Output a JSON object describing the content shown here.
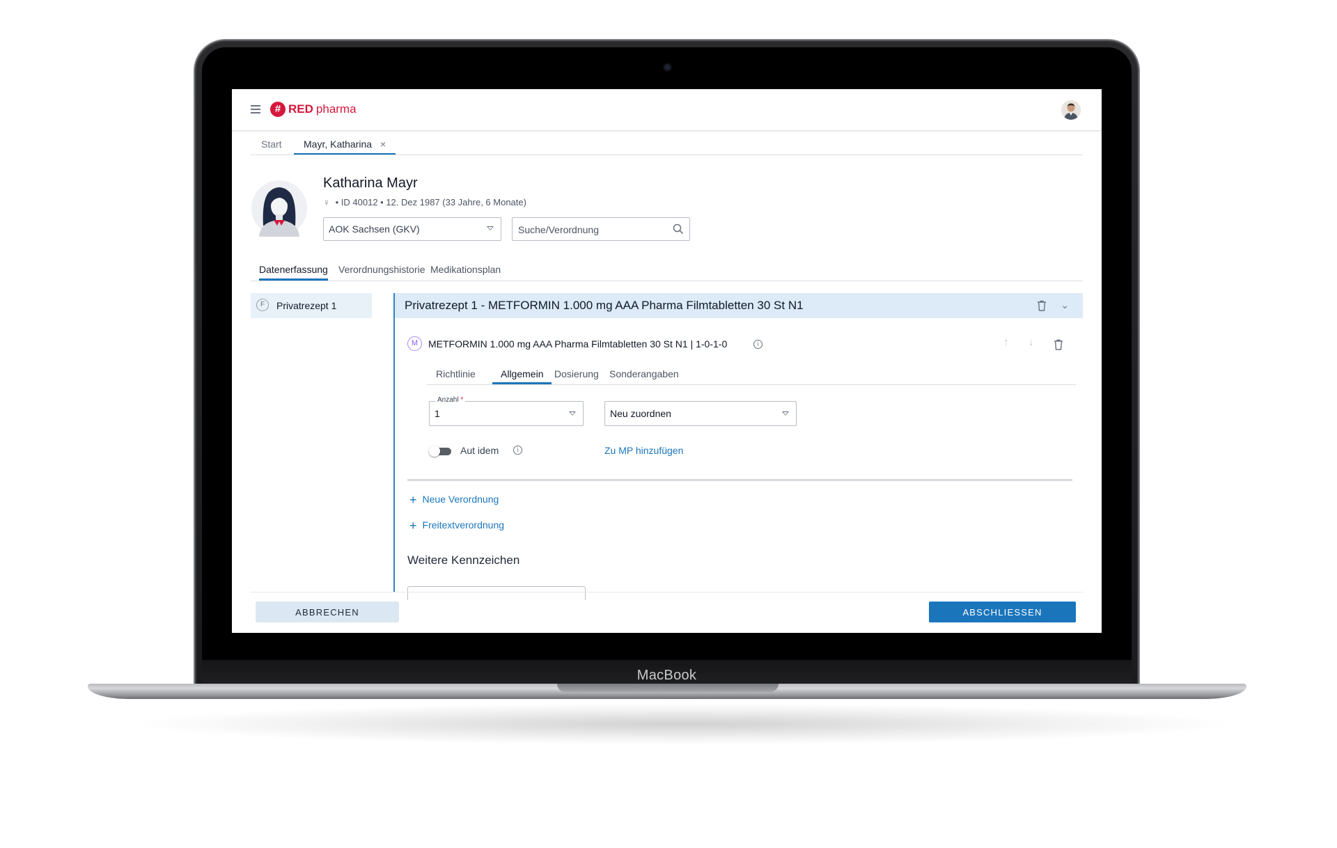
{
  "device": {
    "brand": "MacBook"
  },
  "app": {
    "logo_red": "RED",
    "logo_pharma": "pharma"
  },
  "tabs": {
    "start": "Start",
    "patient": "Mayr, Katharina",
    "close": "×"
  },
  "patient": {
    "name": "Katharina Mayr",
    "gender_icon": "♀",
    "meta": "•  ID 40012  •  12. Dez 1987 (33 Jahre, 6 Monate)",
    "insurance": "AOK Sachsen (GKV)",
    "search_placeholder": "Suche/Verordnung"
  },
  "main_tabs": [
    "Datenerfassung",
    "Verordnungshistorie",
    "Medikationsplan"
  ],
  "left_list": {
    "badge": "F",
    "item": "Privatrezept 1"
  },
  "prescription": {
    "title": "Privatrezept 1 - METFORMIN 1.000 mg AAA Pharma Filmtabletten 30 St N1",
    "chevron": "⌄",
    "medication": {
      "badge": "M",
      "text": "METFORMIN 1.000 mg AAA Pharma Filmtabletten 30 St N1 | 1-0-1-0",
      "info": "i",
      "up": "↑",
      "down": "↓"
    },
    "sub_tabs": [
      "Richtlinie",
      "Allgemein",
      "Dosierung",
      "Sonderangaben"
    ],
    "anzahl": {
      "label": "Anzahl",
      "required_mark": "*",
      "value": "1"
    },
    "assign": {
      "value": "Neu zuordnen"
    },
    "aut_idem": {
      "label": "Aut idem",
      "info": "i",
      "enabled": false
    },
    "mp_link": "Zu MP hinzufügen",
    "add_links": {
      "plus": "+",
      "neue_verordnung": "Neue Verordnung",
      "freitext": "Freitextverordnung"
    },
    "further_section": "Weitere Kennzeichen"
  },
  "footer": {
    "cancel": "ABBRECHEN",
    "finish": "ABSCHLIESSEN"
  },
  "colors": {
    "brand_red": "#d6173c",
    "primary_blue": "#1b75bb",
    "header_highlight": "#dcebf7",
    "cancel_bg": "#dbe8f3"
  },
  "icons": [
    "menu-icon",
    "logo-icon",
    "user-avatar",
    "close-icon",
    "gender-icon",
    "search-icon",
    "trash-icon",
    "chevron-down-icon",
    "info-icon",
    "arrow-up-icon",
    "arrow-down-icon",
    "plus-icon"
  ]
}
